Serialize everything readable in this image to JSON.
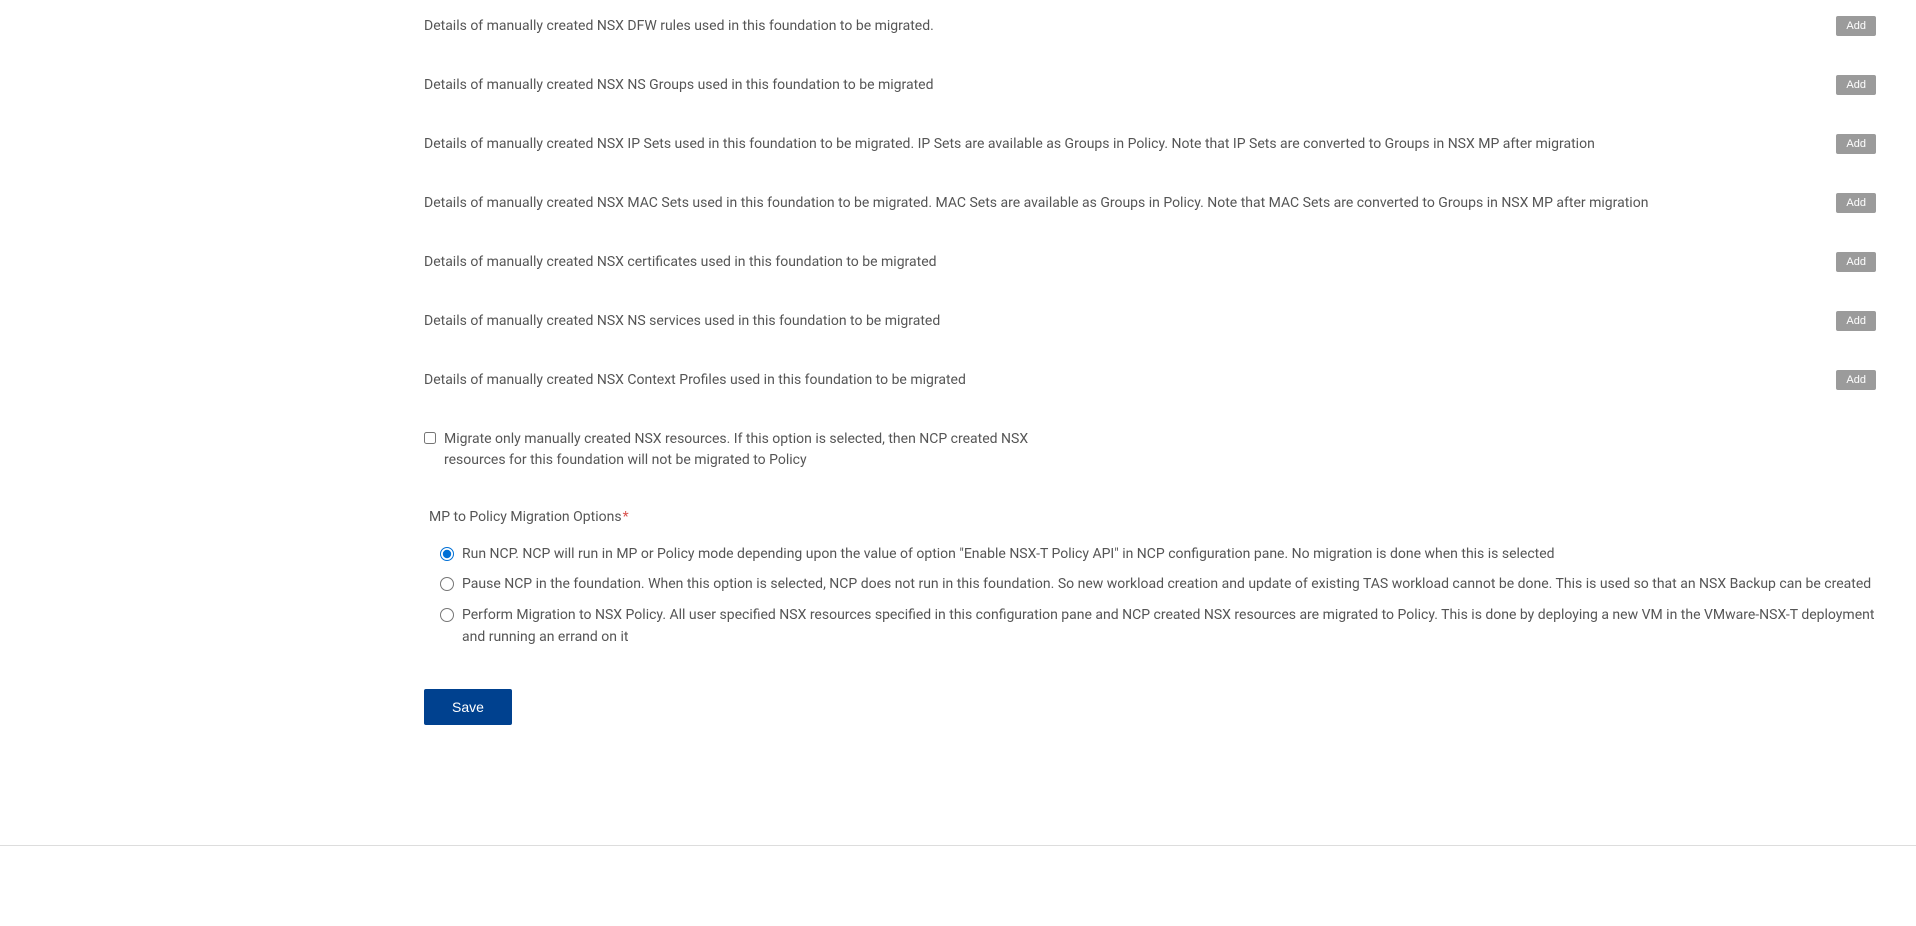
{
  "fields": [
    {
      "label": "Details of manually created NSX DFW rules used in this foundation to be migrated.",
      "addLabel": "Add"
    },
    {
      "label": "Details of manually created NSX NS Groups used in this foundation to be migrated",
      "addLabel": "Add"
    },
    {
      "label": "Details of manually created NSX IP Sets used in this foundation to be migrated. IP Sets are available as Groups in Policy. Note that IP Sets are converted to Groups in NSX MP after migration",
      "addLabel": "Add"
    },
    {
      "label": "Details of manually created NSX MAC Sets used in this foundation to be migrated. MAC Sets are available as Groups in Policy. Note that MAC Sets are converted to Groups in NSX MP after migration",
      "addLabel": "Add"
    },
    {
      "label": "Details of manually created NSX certificates used in this foundation to be migrated",
      "addLabel": "Add"
    },
    {
      "label": "Details of manually created NSX NS services used in this foundation to be migrated",
      "addLabel": "Add"
    },
    {
      "label": "Details of manually created NSX Context Profiles used in this foundation to be migrated",
      "addLabel": "Add"
    }
  ],
  "checkbox": {
    "label": "Migrate only manually created NSX resources. If this option is selected, then NCP created NSX resources for this foundation will not be migrated to Policy"
  },
  "radioSection": {
    "heading": "MP to Policy Migration Options",
    "requiredMarker": "*",
    "options": [
      {
        "label": "Run NCP. NCP will run in MP or Policy mode depending upon the value of option \"Enable NSX-T Policy API\" in NCP configuration pane. No migration is done when this is selected"
      },
      {
        "label": "Pause NCP in the foundation. When this option is selected, NCP does not run in this foundation. So new workload creation and update of existing TAS workload cannot be done. This is used so that an NSX Backup can be created"
      },
      {
        "label": "Perform Migration to NSX Policy. All user specified NSX resources specified in this configuration pane and NCP created NSX resources are migrated to Policy. This is done by deploying a new VM in the VMware-NSX-T deployment and running an errand on it"
      }
    ]
  },
  "saveButton": {
    "label": "Save"
  }
}
